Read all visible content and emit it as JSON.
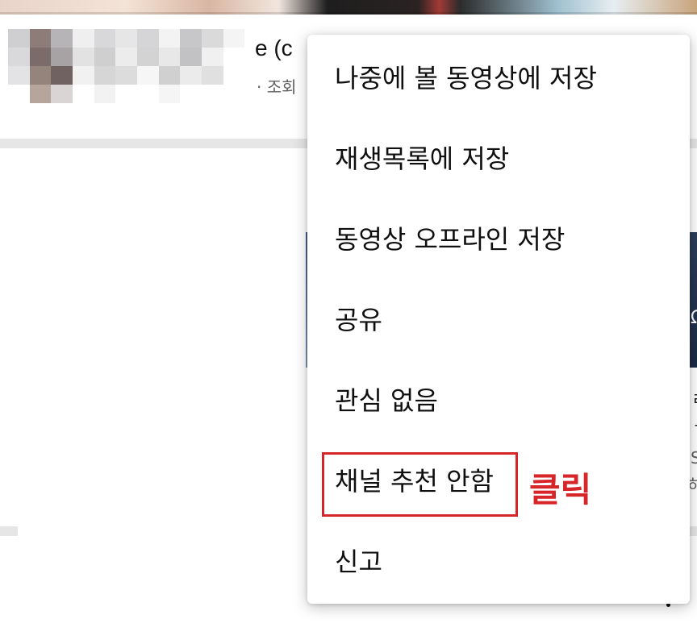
{
  "feed": {
    "video_title_fragment": "e (c",
    "video_meta_fragment": "· 조회",
    "right_edge_glyphs": [
      "Ω",
      "ㄹ",
      "ㅓ",
      "S",
      "히"
    ]
  },
  "menu": {
    "items": [
      {
        "label": "나중에 볼 동영상에 저장"
      },
      {
        "label": "재생목록에 저장"
      },
      {
        "label": "동영상 오프라인 저장"
      },
      {
        "label": "공유"
      },
      {
        "label": "관심 없음"
      },
      {
        "label": "채널 추천 안함"
      },
      {
        "label": "신고"
      }
    ]
  },
  "annotation": {
    "text": "클릭",
    "color": "#d72629"
  }
}
